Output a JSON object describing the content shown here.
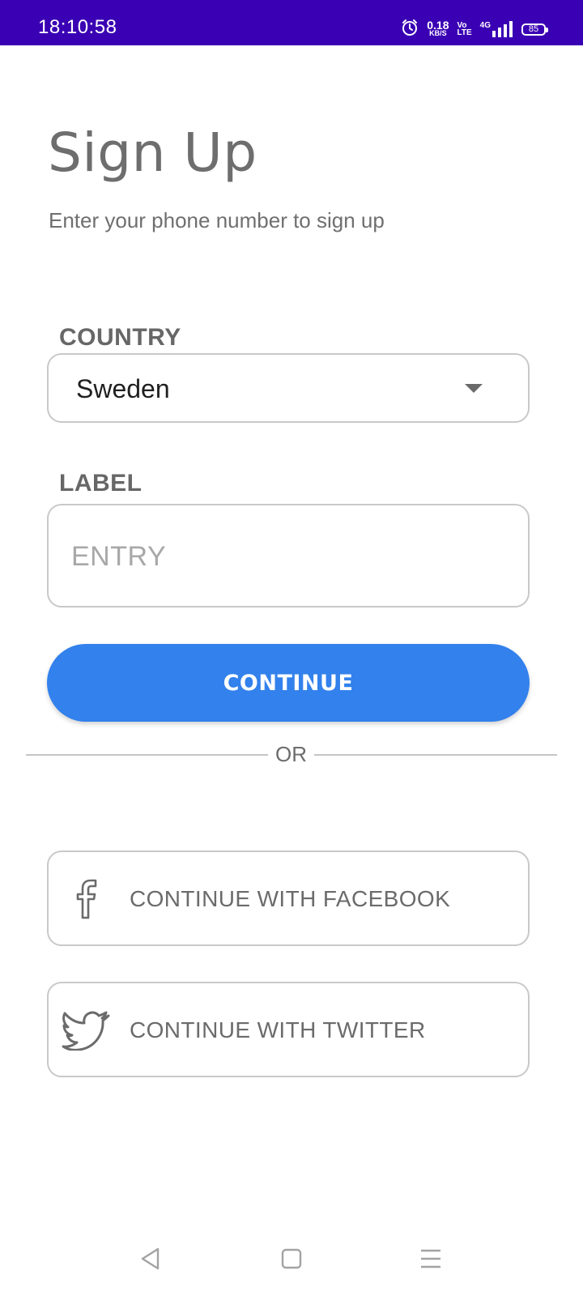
{
  "status_bar": {
    "time": "18:10:58",
    "net_speed_value": "0.18",
    "net_speed_unit": "KB/S",
    "volte_top": "Vo",
    "volte_bottom": "LTE",
    "network": "4G",
    "battery": "85",
    "background_color": "#3a00b4",
    "icons": [
      "alarm-icon",
      "signal-icon",
      "battery-icon"
    ]
  },
  "header": {
    "title": "Sign Up",
    "subtitle": "Enter your phone number to sign up"
  },
  "form": {
    "country_label": "COUNTRY",
    "country_value": "Sweden",
    "entry_label": "LABEL",
    "entry_placeholder": "ENTRY",
    "entry_value": ""
  },
  "actions": {
    "continue_label": "CONTINUE",
    "continue_color": "#3281ec",
    "divider_text": "OR",
    "facebook_label": "CONTINUE WITH FACEBOOK",
    "facebook_icon": "facebook-icon",
    "twitter_label": "CONTINUE WITH TWITTER",
    "twitter_icon": "twitter-icon"
  },
  "nav_bar": {
    "icons": [
      "back-icon",
      "home-icon",
      "menu-icon"
    ]
  }
}
